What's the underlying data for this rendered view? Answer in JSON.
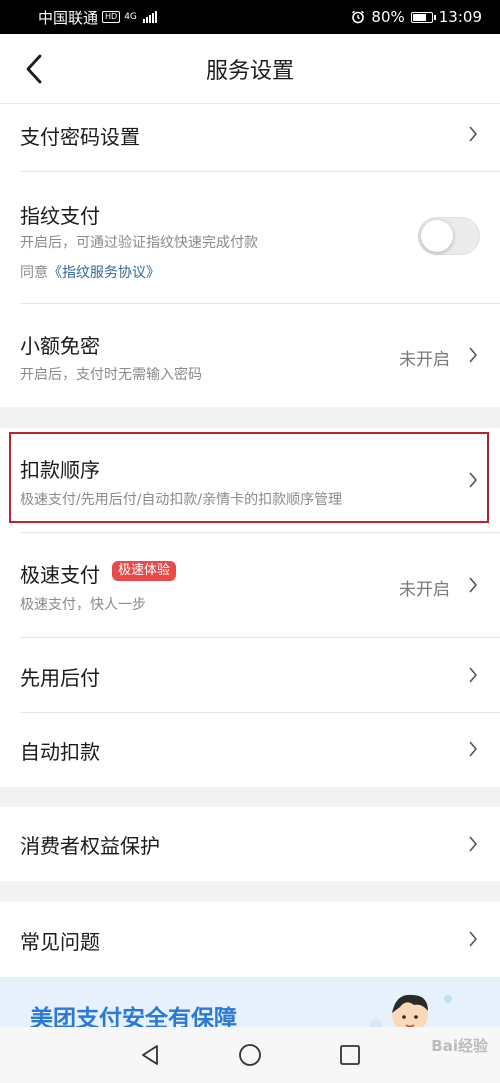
{
  "status_bar": {
    "carrier": "中国联通",
    "hd_badge": "HD",
    "network": "4G",
    "battery": "80%",
    "battery_level": 0.8,
    "time": "13:09"
  },
  "header": {
    "title": "服务设置"
  },
  "icons": {
    "back": "back-arrow-icon",
    "chevron": "chevron-right-icon",
    "alarm": "alarm-clock-icon",
    "nav_back": "triangle-back-icon",
    "nav_home": "circle-home-icon",
    "nav_recent": "square-recent-icon"
  },
  "colors": {
    "highlight_border": "#c0202a",
    "badge_bg": "#e84a4a",
    "link": "#35679a",
    "banner_text": "#2b78d6"
  },
  "settings": {
    "payment_password": {
      "label": "支付密码设置"
    },
    "fingerprint": {
      "label": "指纹支付",
      "desc": "开启后，可通过验证指纹快速完成付款",
      "agreement_prefix": "同意",
      "agreement_link": "《指纹服务协议》",
      "enabled": false
    },
    "small_amount": {
      "label": "小额免密",
      "desc": "开启后，支付时无需输入密码",
      "value": "未开启"
    },
    "deduction_order": {
      "label": "扣款顺序",
      "desc": "极速支付/先用后付/自动扣款/亲情卡的扣款顺序管理"
    },
    "express_pay": {
      "label": "极速支付",
      "badge": "极速体验",
      "desc": "极速支付，快人一步",
      "value": "未开启"
    },
    "pay_later": {
      "label": "先用后付"
    },
    "auto_deduction": {
      "label": "自动扣款"
    },
    "consumer_rights": {
      "label": "消费者权益保护"
    },
    "faq": {
      "label": "常见问题"
    }
  },
  "banner": {
    "text": "美团支付安全有保障"
  },
  "watermark": "Bai经验"
}
